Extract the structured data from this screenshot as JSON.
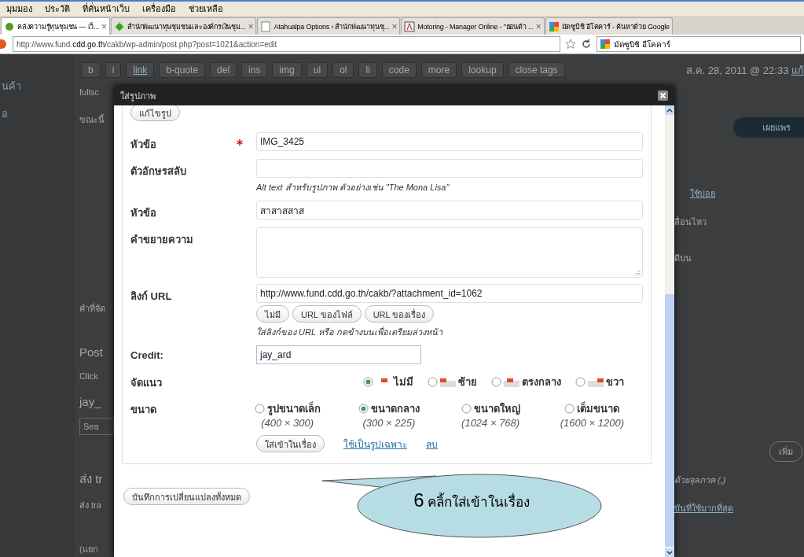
{
  "browser": {
    "menu": [
      "มุมมอง",
      "ประวัติ",
      "ที่คั่นหน้าเว็บ",
      "เครื่องมือ",
      "ช่วยเหลือ"
    ],
    "tabs": [
      {
        "label": "คลังความรู้ทุนชุมชน — เว็...",
        "selected": true,
        "close": "×"
      },
      {
        "label": "สำนักพัฒนาทุนชุมชนและองค์กรเงินชุม...",
        "selected": false,
        "close": "×"
      },
      {
        "label": "Atahualpa Options ‹ สำนักพัฒนาทุนชุ...",
        "selected": false,
        "close": "×"
      },
      {
        "label": "Motoring - Manager Online - \"ฮอนด้า ...",
        "selected": false,
        "close": "×"
      },
      {
        "label": "มัดซูบิชิ อีโคคาร์ - ค้นหาด้วย Google",
        "selected": false
      }
    ],
    "address": "http://www.fund.**cdd.go.th**/cakb/wp-admin/post.php?post=1021&action=edit",
    "search": "มัดซูบิชิ อีโคคาร์"
  },
  "background": {
    "sidebar": [
      "นค้า",
      "อ"
    ],
    "toolbar": [
      "b",
      "i",
      "link",
      "b-quote",
      "del",
      "ins",
      "img",
      "ul",
      "ol",
      "li",
      "code",
      "more",
      "lookup",
      "close tags"
    ],
    "left": {
      "fullscreen": "fullsc",
      "now": "ขณะนี้",
      "words": "คำที่จัด",
      "post": "Post",
      "click": "Click",
      "tag": "jay_",
      "search": "Sea",
      "send": "ส่ง tr",
      "send2": "ส่ง tra",
      "separate": "(แยก"
    },
    "right": {
      "date": "ส.ค. 28, 2011 @ 22:33",
      "edit": "แก้",
      "publish": "เผยแพร",
      "often": "ใช้บ่อย",
      "move": "ลื่อนไหว",
      "top": "ดีบน",
      "add": "เพิ่ม",
      "comma": "ด้วยจุลภาค (,)",
      "most": "บันที่ใช้มากที่สุด"
    }
  },
  "dialog": {
    "title": "ใส่รูปภาพ",
    "edit_button": "แก้ไขรูป",
    "fields": [
      {
        "label": "หัวข้อ",
        "required": true,
        "value": "IMG_3425"
      },
      {
        "label": "ตัวอักษรสลับ",
        "required": false,
        "hint": "Alt text สำหรับรูปภาพ ตัวอย่างเช่น \"The Mona Lisa\""
      },
      {
        "label": "หัวข้อ",
        "required": false,
        "value": "สาสาสสาส"
      },
      {
        "label": "คำขยายความ",
        "required": false,
        "kind": "textarea"
      },
      {
        "label": "ลิงก์ URL",
        "required": false,
        "value": "http://www.fund.cdd.go.th/cakb/?attachment_id=1062",
        "buttons": [
          "ไม่มี",
          "URL ของไฟล์",
          "URL ของเรื่อง"
        ],
        "hint": "ใส่ลิงก์ของ URL หรือ กดข้างบนเพื่อเตรียมล่วงหน้า"
      },
      {
        "label": "Credit:",
        "required": false,
        "value": "jay_ard",
        "kind": "short"
      }
    ],
    "alignment": {
      "label": "จัดแนว",
      "options": [
        {
          "label": "ไม่มี",
          "selected": true
        },
        {
          "label": "ซ้าย",
          "selected": false
        },
        {
          "label": "ตรงกลาง",
          "selected": false
        },
        {
          "label": "ขวา",
          "selected": false
        }
      ]
    },
    "size": {
      "label": "ขนาด",
      "options": [
        {
          "label": "รูปขนาดเล็ก",
          "dims": "(400 × 300)",
          "selected": false
        },
        {
          "label": "ขนาดกลาง",
          "dims": "(300 × 225)",
          "selected": true
        },
        {
          "label": "ขนาดใหญ่",
          "dims": "(1024 × 768)",
          "selected": false
        },
        {
          "label": "เต็มขนาด",
          "dims": "(1600 × 1200)",
          "selected": false
        }
      ]
    },
    "insert_button": "ใส่เข้าในเรื่อง",
    "featured_link": "ใช้เป็นรูปเฉพาะ",
    "delete_link": "ลบ",
    "save_all": "บันทึกการเปลี่ยนแปลงทั้งหมด",
    "callout": {
      "step": "6",
      "text": "คลิ้กใส่เข้าในเรื่อง"
    }
  }
}
